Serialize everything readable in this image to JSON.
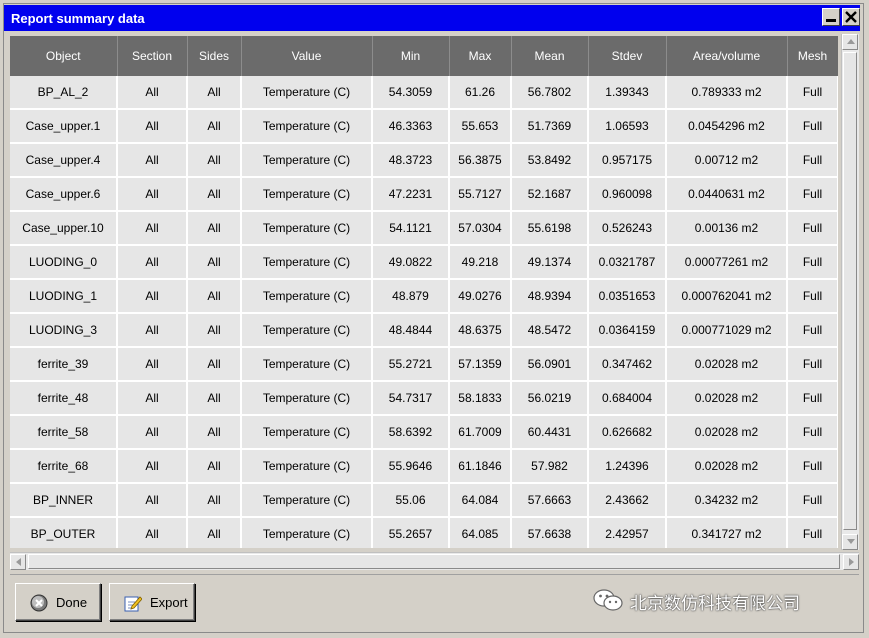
{
  "window": {
    "title": "Report summary data"
  },
  "table": {
    "columns": [
      "Object",
      "Section",
      "Sides",
      "Value",
      "Min",
      "Max",
      "Mean",
      "Stdev",
      "Area/volume",
      "Mesh"
    ],
    "rows": [
      [
        "BP_AL_2",
        "All",
        "All",
        "Temperature (C)",
        "54.3059",
        "61.26",
        "56.7802",
        "1.39343",
        "0.789333 m2",
        "Full"
      ],
      [
        "Case_upper.1",
        "All",
        "All",
        "Temperature (C)",
        "46.3363",
        "55.653",
        "51.7369",
        "1.06593",
        "0.0454296 m2",
        "Full"
      ],
      [
        "Case_upper.4",
        "All",
        "All",
        "Temperature (C)",
        "48.3723",
        "56.3875",
        "53.8492",
        "0.957175",
        "0.00712 m2",
        "Full"
      ],
      [
        "Case_upper.6",
        "All",
        "All",
        "Temperature (C)",
        "47.2231",
        "55.7127",
        "52.1687",
        "0.960098",
        "0.0440631 m2",
        "Full"
      ],
      [
        "Case_upper.10",
        "All",
        "All",
        "Temperature (C)",
        "54.1121",
        "57.0304",
        "55.6198",
        "0.526243",
        "0.00136 m2",
        "Full"
      ],
      [
        "LUODING_0",
        "All",
        "All",
        "Temperature (C)",
        "49.0822",
        "49.218",
        "49.1374",
        "0.0321787",
        "0.00077261 m2",
        "Full"
      ],
      [
        "LUODING_1",
        "All",
        "All",
        "Temperature (C)",
        "48.879",
        "49.0276",
        "48.9394",
        "0.0351653",
        "0.000762041 m2",
        "Full"
      ],
      [
        "LUODING_3",
        "All",
        "All",
        "Temperature (C)",
        "48.4844",
        "48.6375",
        "48.5472",
        "0.0364159",
        "0.000771029 m2",
        "Full"
      ],
      [
        "ferrite_39",
        "All",
        "All",
        "Temperature (C)",
        "55.2721",
        "57.1359",
        "56.0901",
        "0.347462",
        "0.02028 m2",
        "Full"
      ],
      [
        "ferrite_48",
        "All",
        "All",
        "Temperature (C)",
        "54.7317",
        "58.1833",
        "56.0219",
        "0.684004",
        "0.02028 m2",
        "Full"
      ],
      [
        "ferrite_58",
        "All",
        "All",
        "Temperature (C)",
        "58.6392",
        "61.7009",
        "60.4431",
        "0.626682",
        "0.02028 m2",
        "Full"
      ],
      [
        "ferrite_68",
        "All",
        "All",
        "Temperature (C)",
        "55.9646",
        "61.1846",
        "57.982",
        "1.24396",
        "0.02028 m2",
        "Full"
      ],
      [
        "BP_INNER",
        "All",
        "All",
        "Temperature (C)",
        "55.06",
        "64.084",
        "57.6663",
        "2.43662",
        "0.34232 m2",
        "Full"
      ],
      [
        "BP_OUTER",
        "All",
        "All",
        "Temperature (C)",
        "55.2657",
        "64.085",
        "57.6638",
        "2.42957",
        "0.341727 m2",
        "Full"
      ]
    ]
  },
  "buttons": {
    "done": "Done",
    "export": "Export"
  },
  "icons": {
    "done": "cancel-circle-icon",
    "export": "export-pencil-icon",
    "watermark": "wechat-icon"
  },
  "watermark": {
    "text": "北京数仿科技有限公司"
  },
  "colors": {
    "titlebar": "#0000ee",
    "header": "#6b6b6b",
    "cell": "#e6e6e6"
  }
}
